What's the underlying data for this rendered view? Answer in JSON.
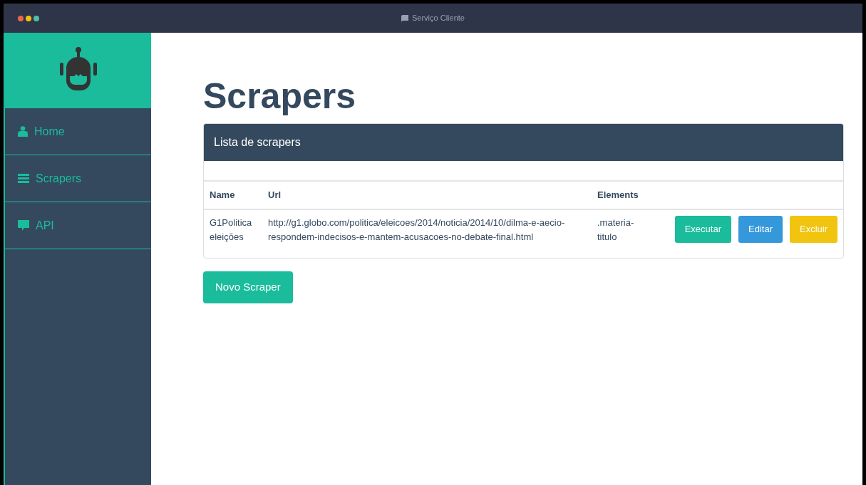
{
  "window": {
    "title": "Serviço Cliente"
  },
  "sidebar": {
    "items": [
      {
        "label": "Home",
        "kind": "person"
      },
      {
        "label": "Scrapers",
        "kind": "bars"
      },
      {
        "label": "API",
        "kind": "speech"
      }
    ]
  },
  "page_title": "Scrapers",
  "panel": {
    "title": "Lista de scrapers",
    "table": {
      "columns": [
        "Name",
        "Url",
        "Elements"
      ],
      "rows": [
        {
          "cells": [
            "G1Politica eleições",
            "http://g1.globo.com/politica/eleicoes/2014/noticia/2014/10/dilma-e-aecio-respondem-indecisos-e-mantem-acusacoes-no-debate-final.html",
            ".materia-titulo"
          ],
          "actions": [
            {
              "label": "Executar",
              "kind": "run"
            },
            {
              "label": "Editar",
              "kind": "edit"
            },
            {
              "label": "Excluir",
              "kind": "delete"
            }
          ]
        }
      ]
    }
  },
  "new_button": "Novo Scraper"
}
